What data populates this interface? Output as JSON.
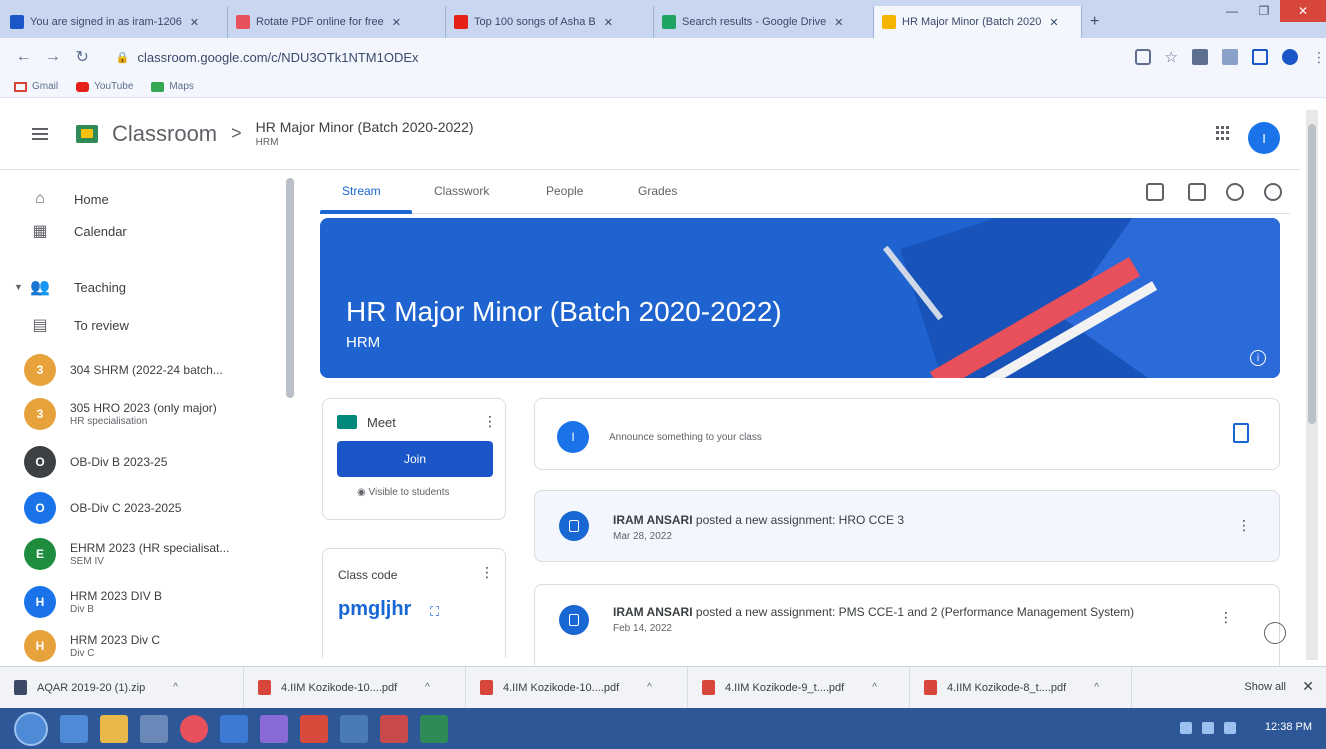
{
  "browser": {
    "tabs": [
      {
        "label": "You are signed in as iram-1206",
        "color": "#1a56c8"
      },
      {
        "label": "Rotate PDF online for free",
        "color": "#e8505b"
      },
      {
        "label": "Top 100 songs of Asha B",
        "color": "#e62117"
      },
      {
        "label": "Search results - Google Drive",
        "color": "#1fa463"
      },
      {
        "label": "HR Major Minor (Batch 2020",
        "color": "#f4b400"
      }
    ],
    "url": "classroom.google.com/c/NDU3OTk1NTM1ODEx",
    "bookmarks": [
      "Gmail",
      "YouTube",
      "Maps"
    ]
  },
  "header": {
    "brand": "Classroom",
    "separator": ">",
    "class_title": "HR Major Minor (Batch 2020-2022)",
    "class_section": "HRM",
    "avatar_letter": "I"
  },
  "sidebar": {
    "nav": [
      {
        "label": "Home",
        "icon": "home-icon"
      },
      {
        "label": "Calendar",
        "icon": "calendar-icon"
      },
      {
        "label": "Teaching",
        "icon": "teaching-icon"
      },
      {
        "label": "To review",
        "icon": "to-review-icon"
      }
    ],
    "courses": [
      {
        "letter": "3",
        "title": "304 SHRM (2022-24 batch...",
        "subtitle": "",
        "color": "#e8a23b"
      },
      {
        "letter": "3",
        "title": "305 HRO 2023 (only major)",
        "subtitle": "HR specialisation",
        "color": "#e8a23b"
      },
      {
        "letter": "O",
        "title": "OB-Div B 2023-25",
        "subtitle": "",
        "color": "#3c4043"
      },
      {
        "letter": "O",
        "title": "OB-Div C 2023-2025",
        "subtitle": "",
        "color": "#1a73e8"
      },
      {
        "letter": "E",
        "title": "EHRM 2023 (HR specialisat...",
        "subtitle": "SEM IV",
        "color": "#1e8e3e"
      },
      {
        "letter": "H",
        "title": "HRM 2023 DIV B",
        "subtitle": "Div B",
        "color": "#1a73e8"
      },
      {
        "letter": "H",
        "title": "HRM 2023 Div C",
        "subtitle": "Div C",
        "color": "#e8a23b"
      }
    ]
  },
  "main": {
    "tabs": [
      "Stream",
      "Classwork",
      "People",
      "Grades"
    ],
    "banner": {
      "title": "HR Major Minor (Batch 2020-2022)",
      "subtitle": "HRM"
    },
    "meet": {
      "title": "Meet",
      "join": "Join",
      "visibility": "Visible to students"
    },
    "class_code": {
      "label": "Class code",
      "value": "pmgljhr"
    },
    "announce": {
      "avatar_letter": "I",
      "placeholder": "Announce something to your class"
    },
    "posts": [
      {
        "author": "IRAM ANSARI",
        "action": "posted a new assignment: HRO CCE 3",
        "date": "Mar 28, 2022"
      },
      {
        "author": "IRAM ANSARI",
        "action": "posted a new assignment: PMS CCE-1 and 2 (Performance Management System)",
        "date": "Feb 14, 2022"
      }
    ]
  },
  "downloads": {
    "items": [
      "AQAR 2019-20 (1).zip",
      "4.IIM Kozikode-10....pdf",
      "4.IIM Kozikode-10....pdf",
      "4.IIM Kozikode-9_t....pdf",
      "4.IIM Kozikode-8_t....pdf"
    ],
    "show_all": "Show all"
  },
  "taskbar": {
    "clock": "12:38 PM"
  }
}
